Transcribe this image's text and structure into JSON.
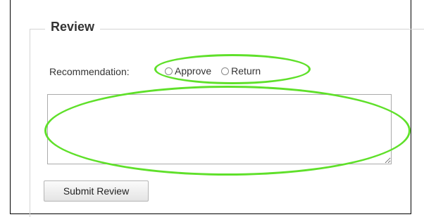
{
  "review": {
    "legend": "Review",
    "recommendation_label": "Recommendation:",
    "options": [
      {
        "label": "Approve",
        "selected": false
      },
      {
        "label": "Return",
        "selected": false
      }
    ],
    "comments_value": "",
    "submit_label": "Submit Review"
  },
  "annotations": {
    "color": "#5fe02a"
  }
}
